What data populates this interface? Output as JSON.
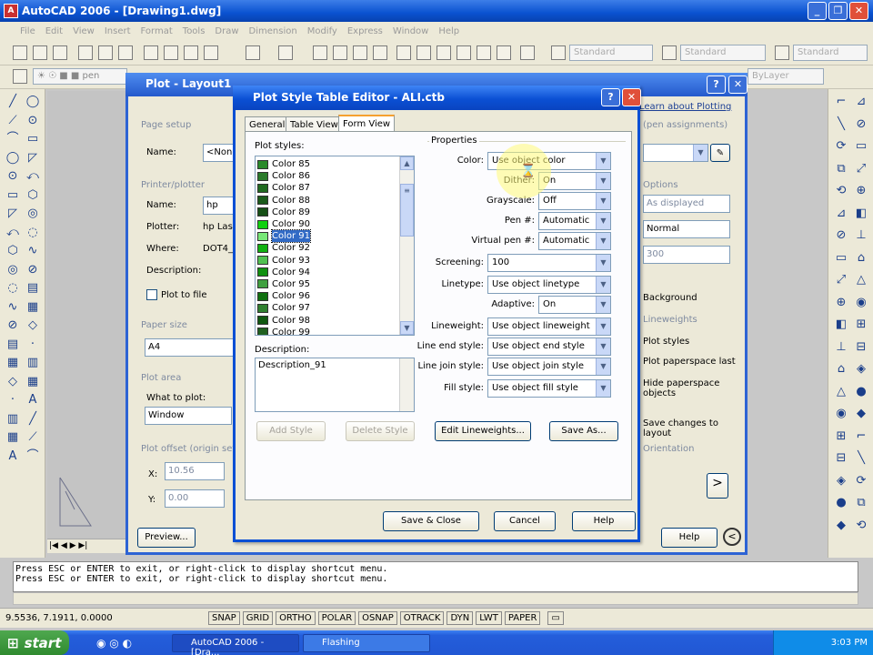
{
  "app": {
    "title": "AutoCAD 2006 - [Drawing1.dwg]",
    "menu": [
      "File",
      "Edit",
      "View",
      "Insert",
      "Format",
      "Tools",
      "Draw",
      "Dimension",
      "Modify",
      "Express",
      "Window",
      "Help"
    ],
    "toolbar_combos": [
      "Standard",
      "Standard",
      "Standard"
    ],
    "layer_combo": "ByLayer"
  },
  "plot_dialog": {
    "title": "Plot - Layout1",
    "help_link": "Learn about Plotting",
    "page_setup_label": "Page setup",
    "name_label": "Name:",
    "name_value": "<None>",
    "printer_label": "Printer/plotter",
    "printer_name_label": "Name:",
    "printer_name_value": "hp",
    "plotter_label": "Plotter:",
    "plotter_value": "hp Lase",
    "where_label": "Where:",
    "where_value": "DOT4_0",
    "description_label": "Description:",
    "plot_to_file": "Plot to file",
    "paper_size_label": "Paper size",
    "paper_size_value": "A4",
    "plot_area_label": "Plot area",
    "what_to_plot_label": "What to plot:",
    "what_to_plot_value": "Window",
    "plot_offset_label": "Plot offset (origin set",
    "x_label": "X:",
    "x_value": "10.56",
    "y_label": "Y:",
    "y_value": "0.00",
    "preview_button": "Preview...",
    "help_button": "Help",
    "assignments_label": "(pen assignments)",
    "options_label": "Options",
    "as_displayed": "As displayed",
    "quality_value": "Normal",
    "dpi_value": "300",
    "right_options": [
      "Background",
      "Lineweights",
      "Plot styles",
      "Plot paperspace last",
      "Hide paperspace objects",
      "Save changes to layout"
    ],
    "orientation_label": "Orientation"
  },
  "editor": {
    "title": "Plot Style Table Editor - ALI.ctb",
    "tabs": [
      "General",
      "Table View",
      "Form View"
    ],
    "active_tab": "Form View",
    "plot_styles_label": "Plot styles:",
    "plot_styles": [
      {
        "name": "Color 85",
        "color": "#2a8a2a"
      },
      {
        "name": "Color 86",
        "color": "#2a7a2a"
      },
      {
        "name": "Color 87",
        "color": "#206a20"
      },
      {
        "name": "Color 88",
        "color": "#1a5a1a"
      },
      {
        "name": "Color 89",
        "color": "#165016"
      },
      {
        "name": "Color 90",
        "color": "#10d010"
      },
      {
        "name": "Color 91",
        "color": "#78e878"
      },
      {
        "name": "Color 92",
        "color": "#10b010"
      },
      {
        "name": "Color 93",
        "color": "#50c050"
      },
      {
        "name": "Color 94",
        "color": "#109010"
      },
      {
        "name": "Color 95",
        "color": "#40a040"
      },
      {
        "name": "Color 96",
        "color": "#107010"
      },
      {
        "name": "Color 97",
        "color": "#308030"
      },
      {
        "name": "Color 98",
        "color": "#105810"
      },
      {
        "name": "Color 99",
        "color": "#206020"
      }
    ],
    "selected_style": "Color 91",
    "description_label": "Description:",
    "description_value": "Description_91",
    "add_style_button": "Add Style",
    "delete_style_button": "Delete Style",
    "properties_label": "Properties",
    "properties": [
      {
        "label": "Color:",
        "value": "Use object color"
      },
      {
        "label": "Dither:",
        "value": "On"
      },
      {
        "label": "Grayscale:",
        "value": "Off"
      },
      {
        "label": "Pen #:",
        "value": "Automatic"
      },
      {
        "label": "Virtual pen #:",
        "value": "Automatic"
      },
      {
        "label": "Screening:",
        "value": "100"
      },
      {
        "label": "Linetype:",
        "value": "Use object linetype"
      },
      {
        "label": "Adaptive:",
        "value": "On"
      },
      {
        "label": "Lineweight:",
        "value": "Use object lineweight"
      },
      {
        "label": "Line end style:",
        "value": "Use object end style"
      },
      {
        "label": "Line join style:",
        "value": "Use object join style"
      },
      {
        "label": "Fill style:",
        "value": "Use object fill style"
      }
    ],
    "edit_lineweights_button": "Edit Lineweights...",
    "save_as_button": "Save As...",
    "save_close_button": "Save & Close",
    "cancel_button": "Cancel",
    "help_button": "Help"
  },
  "command_line": [
    "Press ESC or ENTER to exit, or right-click to display shortcut menu.",
    "Press ESC or ENTER to exit, or right-click to display shortcut menu."
  ],
  "status": {
    "coords": "9.5536, 7.1911, 0.0000",
    "toggles": [
      "SNAP",
      "GRID",
      "ORTHO",
      "POLAR",
      "OSNAP",
      "OTRACK",
      "DYN",
      "LWT",
      "PAPER"
    ]
  },
  "taskbar": {
    "start": "start",
    "items": [
      "AutoCAD 2006 - [Dra...",
      "Flashing"
    ],
    "clock": "3:03 PM"
  }
}
